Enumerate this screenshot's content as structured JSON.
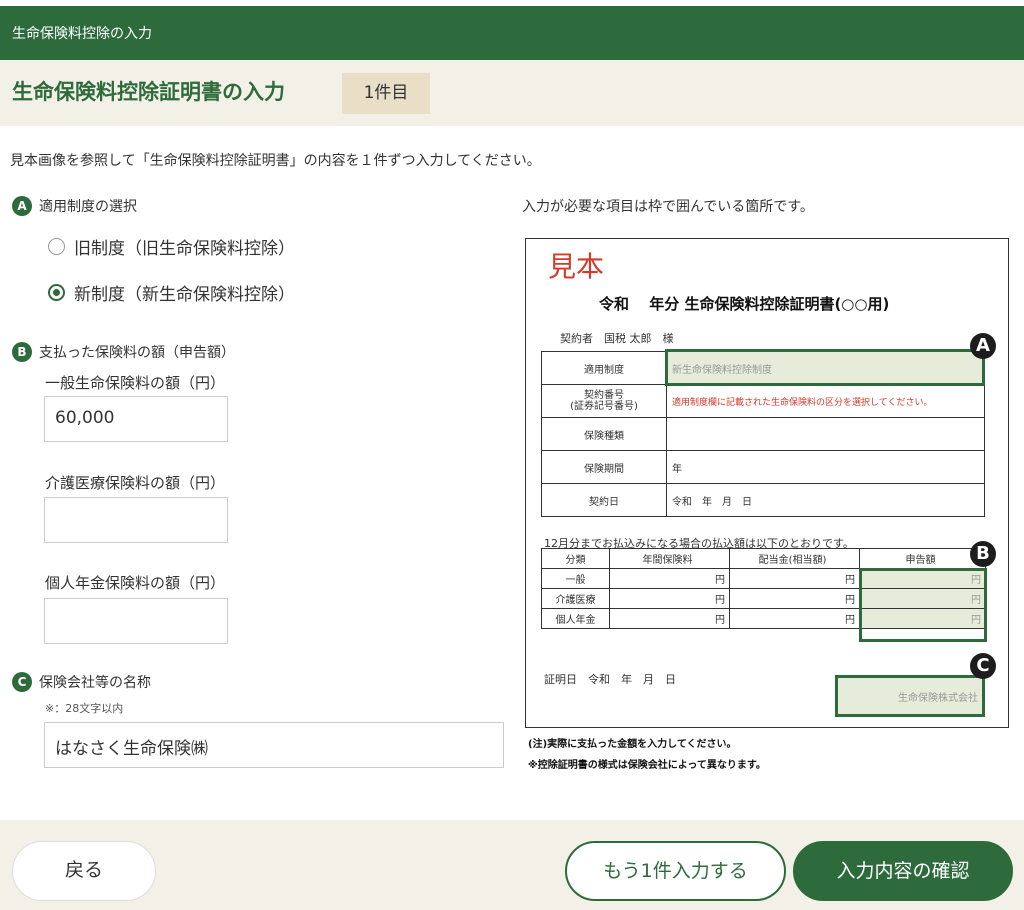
{
  "header": {
    "breadcrumb": "生命保険料控除の入力",
    "title": "生命保険料控除証明書の入力",
    "count_badge": "1件目"
  },
  "intro": "見本画像を参照して「生命保険料控除証明書」の内容を１件ずつ入力してください。",
  "section_a": {
    "marker": "A",
    "heading": "適用制度の選択",
    "options": [
      {
        "label": "旧制度（旧生命保険料控除）",
        "selected": false
      },
      {
        "label": "新制度（新生命保険料控除）",
        "selected": true
      }
    ]
  },
  "section_b": {
    "marker": "B",
    "heading": "支払った保険料の額（申告額）",
    "general_label": "一般生命保険料の額（円）",
    "general_value": "60,000",
    "care_label": "介護医療保険料の額（円）",
    "care_value": "",
    "pension_label": "個人年金保険料の額（円）",
    "pension_value": ""
  },
  "section_c": {
    "marker": "C",
    "heading": "保険会社等の名称",
    "note": "※：28文字以内",
    "company_value": "はなさく生命保険㈱"
  },
  "sample": {
    "caption": "入力が必要な項目は枠で囲んでいる箇所です。",
    "stamp": "見本",
    "title": "令和　 年分 生命保険料控除証明書(○○用)",
    "holder": "契約者　国税 太郎　様",
    "rows": [
      {
        "label": "適用制度",
        "value": "新生命保険料控除制度"
      },
      {
        "label": "契約番号\n(証券記号番号)",
        "value": "適用制度欄に記載された生命保険料の区分を選択してください。"
      },
      {
        "label": "保険種類",
        "value": ""
      },
      {
        "label": "保険期間",
        "value": "年"
      },
      {
        "label": "契約日",
        "value": "令和　年　月　日"
      }
    ],
    "pay_note": "12月分までお払込みになる場合の払込額は以下のとおりです。",
    "pay_headers": [
      "分類",
      "年間保険料",
      "配当金(相当額)",
      "申告額"
    ],
    "pay_rows": [
      {
        "cat": "一般",
        "annual": "円",
        "dividend": "円",
        "declared": "円"
      },
      {
        "cat": "介護医療",
        "annual": "円",
        "dividend": "円",
        "declared": "円"
      },
      {
        "cat": "個人年金",
        "annual": "円",
        "dividend": "円",
        "declared": "円"
      }
    ],
    "cert_date": "証明日　令和　年　月　日",
    "company": "生命保険株式会社",
    "marker_a": "A",
    "marker_b": "B",
    "marker_c": "C",
    "note1": "(注)実際に支払った金額を入力してください。",
    "note2": "※控除証明書の様式は保険会社によって異なります。"
  },
  "footer": {
    "back": "戻る",
    "add_more": "もう1件入力する",
    "confirm": "入力内容の確認"
  },
  "colors": {
    "brand": "#2e6b3c",
    "accent_red": "#d23a2a",
    "beige": "#f3f0e8"
  }
}
